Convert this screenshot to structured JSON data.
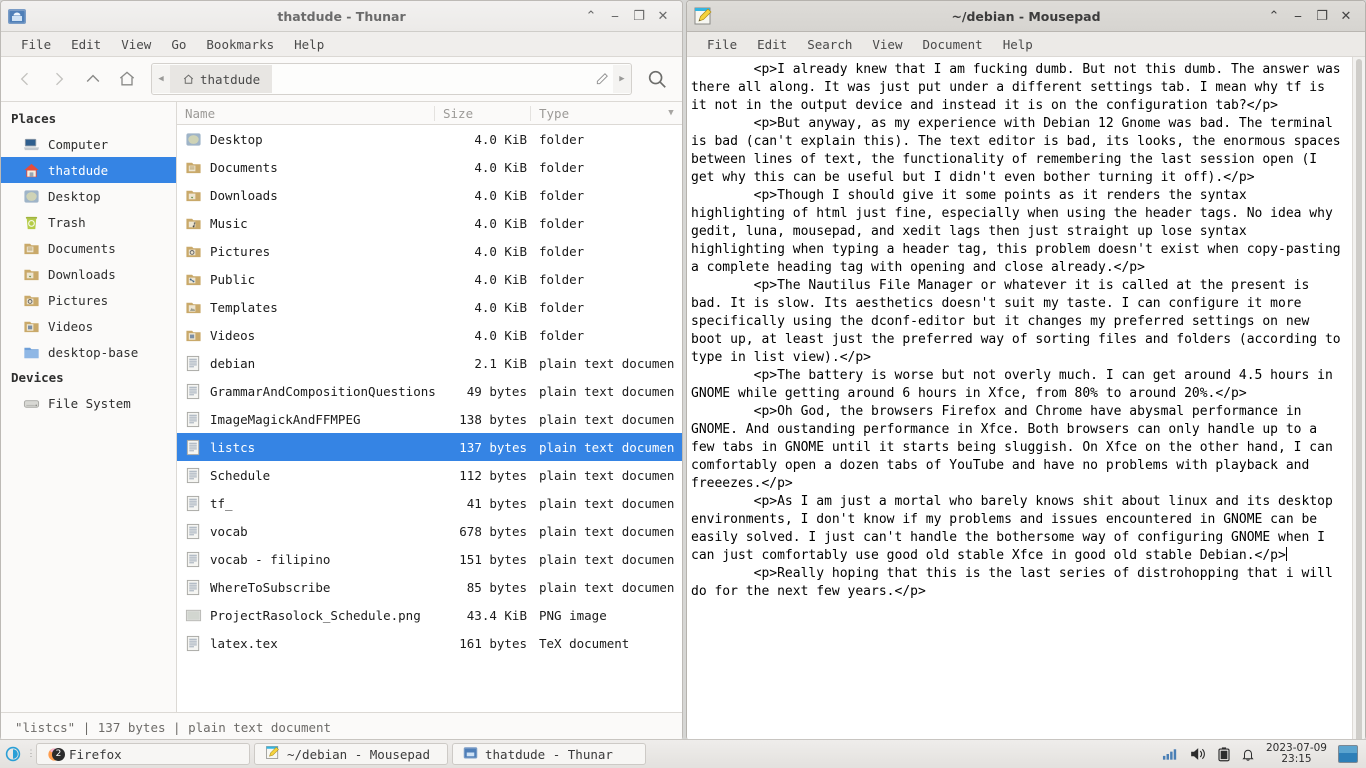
{
  "thunar": {
    "title": "thatdude - Thunar",
    "icon": "folder-icon",
    "window_buttons": [
      "shade",
      "minimize",
      "maximize",
      "close"
    ],
    "menus": [
      "File",
      "Edit",
      "View",
      "Go",
      "Bookmarks",
      "Help"
    ],
    "toolbar": {
      "back": "back-icon",
      "forward": "forward-icon",
      "up": "up-icon",
      "home": "home-icon",
      "search": "search-icon",
      "edit_path": "pencil-icon"
    },
    "pathbar": {
      "crumb": "thatdude"
    },
    "sidebar": {
      "places_label": "Places",
      "places": [
        {
          "label": "Computer",
          "icon": "computer-icon",
          "selected": false
        },
        {
          "label": "thatdude",
          "icon": "home-icon",
          "selected": true
        },
        {
          "label": "Desktop",
          "icon": "desktop-icon",
          "selected": false
        },
        {
          "label": "Trash",
          "icon": "trash-icon",
          "selected": false
        },
        {
          "label": "Documents",
          "icon": "documents-folder-icon",
          "selected": false
        },
        {
          "label": "Downloads",
          "icon": "downloads-folder-icon",
          "selected": false
        },
        {
          "label": "Pictures",
          "icon": "pictures-folder-icon",
          "selected": false
        },
        {
          "label": "Videos",
          "icon": "videos-folder-icon",
          "selected": false
        },
        {
          "label": "desktop-base",
          "icon": "folder-icon",
          "selected": false
        }
      ],
      "devices_label": "Devices",
      "devices": [
        {
          "label": "File System",
          "icon": "harddisk-icon",
          "selected": false
        }
      ]
    },
    "columns": [
      "Name",
      "Size",
      "Type"
    ],
    "files": [
      {
        "name": "Desktop",
        "size": "4.0 KiB",
        "type": "folder",
        "icon": "desktop-folder-icon",
        "selected": false
      },
      {
        "name": "Documents",
        "size": "4.0 KiB",
        "type": "folder",
        "icon": "documents-folder-icon",
        "selected": false
      },
      {
        "name": "Downloads",
        "size": "4.0 KiB",
        "type": "folder",
        "icon": "downloads-folder-icon",
        "selected": false
      },
      {
        "name": "Music",
        "size": "4.0 KiB",
        "type": "folder",
        "icon": "music-folder-icon",
        "selected": false
      },
      {
        "name": "Pictures",
        "size": "4.0 KiB",
        "type": "folder",
        "icon": "pictures-folder-icon",
        "selected": false
      },
      {
        "name": "Public",
        "size": "4.0 KiB",
        "type": "folder",
        "icon": "public-folder-icon",
        "selected": false
      },
      {
        "name": "Templates",
        "size": "4.0 KiB",
        "type": "folder",
        "icon": "templates-folder-icon",
        "selected": false
      },
      {
        "name": "Videos",
        "size": "4.0 KiB",
        "type": "folder",
        "icon": "videos-folder-icon",
        "selected": false
      },
      {
        "name": "debian",
        "size": "2.1 KiB",
        "type": "plain text documen",
        "icon": "text-file-icon",
        "selected": false
      },
      {
        "name": "GrammarAndCompositionQuestions",
        "size": "49 bytes",
        "type": "plain text documen",
        "icon": "text-file-icon",
        "selected": false
      },
      {
        "name": "ImageMagickAndFFMPEG",
        "size": "138 bytes",
        "type": "plain text documen",
        "icon": "text-file-icon",
        "selected": false
      },
      {
        "name": "listcs",
        "size": "137 bytes",
        "type": "plain text documen",
        "icon": "text-file-icon",
        "selected": true
      },
      {
        "name": "Schedule",
        "size": "112 bytes",
        "type": "plain text documen",
        "icon": "text-file-icon",
        "selected": false
      },
      {
        "name": "tf_",
        "size": "41 bytes",
        "type": "plain text documen",
        "icon": "text-file-icon",
        "selected": false
      },
      {
        "name": "vocab",
        "size": "678 bytes",
        "type": "plain text documen",
        "icon": "text-file-icon",
        "selected": false
      },
      {
        "name": "vocab - filipino",
        "size": "151 bytes",
        "type": "plain text documen",
        "icon": "text-file-icon",
        "selected": false
      },
      {
        "name": "WhereToSubscribe",
        "size": "85 bytes",
        "type": "plain text documen",
        "icon": "text-file-icon",
        "selected": false
      },
      {
        "name": "ProjectRasolock_Schedule.png",
        "size": "43.4 KiB",
        "type": "PNG image",
        "icon": "image-file-icon",
        "selected": false
      },
      {
        "name": "latex.tex",
        "size": "161 bytes",
        "type": "TeX document",
        "icon": "text-file-icon",
        "selected": false
      }
    ],
    "statusbar": "\"listcs\"  |  137 bytes  |  plain text document"
  },
  "mousepad": {
    "title": "~/debian - Mousepad",
    "icon": "notepad-icon",
    "window_buttons": [
      "shade",
      "minimize",
      "maximize",
      "close"
    ],
    "menus": [
      "File",
      "Edit",
      "Search",
      "View",
      "Document",
      "Help"
    ],
    "text_before_caret": "        <p>I already knew that I am fucking dumb. But not this dumb. The answer was\nthere all along. It was just put under a different settings tab. I mean why tf is\nit not in the output device and instead it is on the configuration tab?</p>\n        <p>But anyway, as my experience with Debian 12 Gnome was bad. The terminal\nis bad (can't explain this). The text editor is bad, its looks, the enormous spaces\nbetween lines of text, the functionality of remembering the last session open (I\nget why this can be useful but I didn't even bother turning it off).</p>\n        <p>Though I should give it some points as it renders the syntax\nhighlighting of html just fine, especially when using the header tags. No idea why\ngedit, luna, mousepad, and xedit lags then just straight up lose syntax\nhighlighting when typing a header tag, this problem doesn't exist when copy-pasting\na complete heading tag with opening and close already.</p>\n        <p>The Nautilus File Manager or whatever it is called at the present is\nbad. It is slow. Its aesthetics doesn't suit my taste. I can configure it more\nspecifically using the dconf-editor but it changes my preferred settings on new\nboot up, at least just the preferred way of sorting files and folders (according to\ntype in list view).</p>\n        <p>The battery is worse but not overly much. I can get around 4.5 hours in\nGNOME while getting around 6 hours in Xfce, from 80% to around 20%.</p>\n        <p>Oh God, the browsers Firefox and Chrome have abysmal performance in\nGNOME. And oustanding performance in Xfce. Both browsers can only handle up to a\nfew tabs in GNOME until it starts being sluggish. On Xfce on the other hand, I can\ncomfortably open a dozen tabs of YouTube and have no problems with playback and\nfreeezes.</p>\n        <p>As I am just a mortal who barely knows shit about linux and its desktop\nenvironments, I don't know if my problems and issues encountered in GNOME can be\neasily solved. I just can't handle the bothersome way of configuring GNOME when I\ncan just comfortably use good old stable Xfce in good old stable Debian.</p>",
    "text_after_caret": "\n        <p>Really hoping that this is the last series of distrohopping that i will\ndo for the next few years.</p>"
  },
  "taskbar": {
    "start_icon": "xfce-menu-icon",
    "tasks": [
      {
        "label": "Firefox",
        "icon": "firefox-icon",
        "badge": "2"
      },
      {
        "label": "~/debian - Mousepad",
        "icon": "notepad-icon",
        "badge": ""
      },
      {
        "label": "thatdude - Thunar",
        "icon": "folder-icon",
        "badge": ""
      }
    ],
    "tray": [
      "network-signal-icon",
      "volume-icon",
      "battery-icon",
      "notification-bell-icon"
    ],
    "clock_date": "2023-07-09",
    "clock_time": "23:15",
    "show_desktop": "show-desktop-icon"
  },
  "colors": {
    "selection_blue": "#3584e4",
    "window_bg": "#fcfcfc",
    "titlebar_active": "#d8d6d2",
    "titlebar_inactive": "#f0eeec",
    "desktop_bg": "#d6d6d4"
  }
}
